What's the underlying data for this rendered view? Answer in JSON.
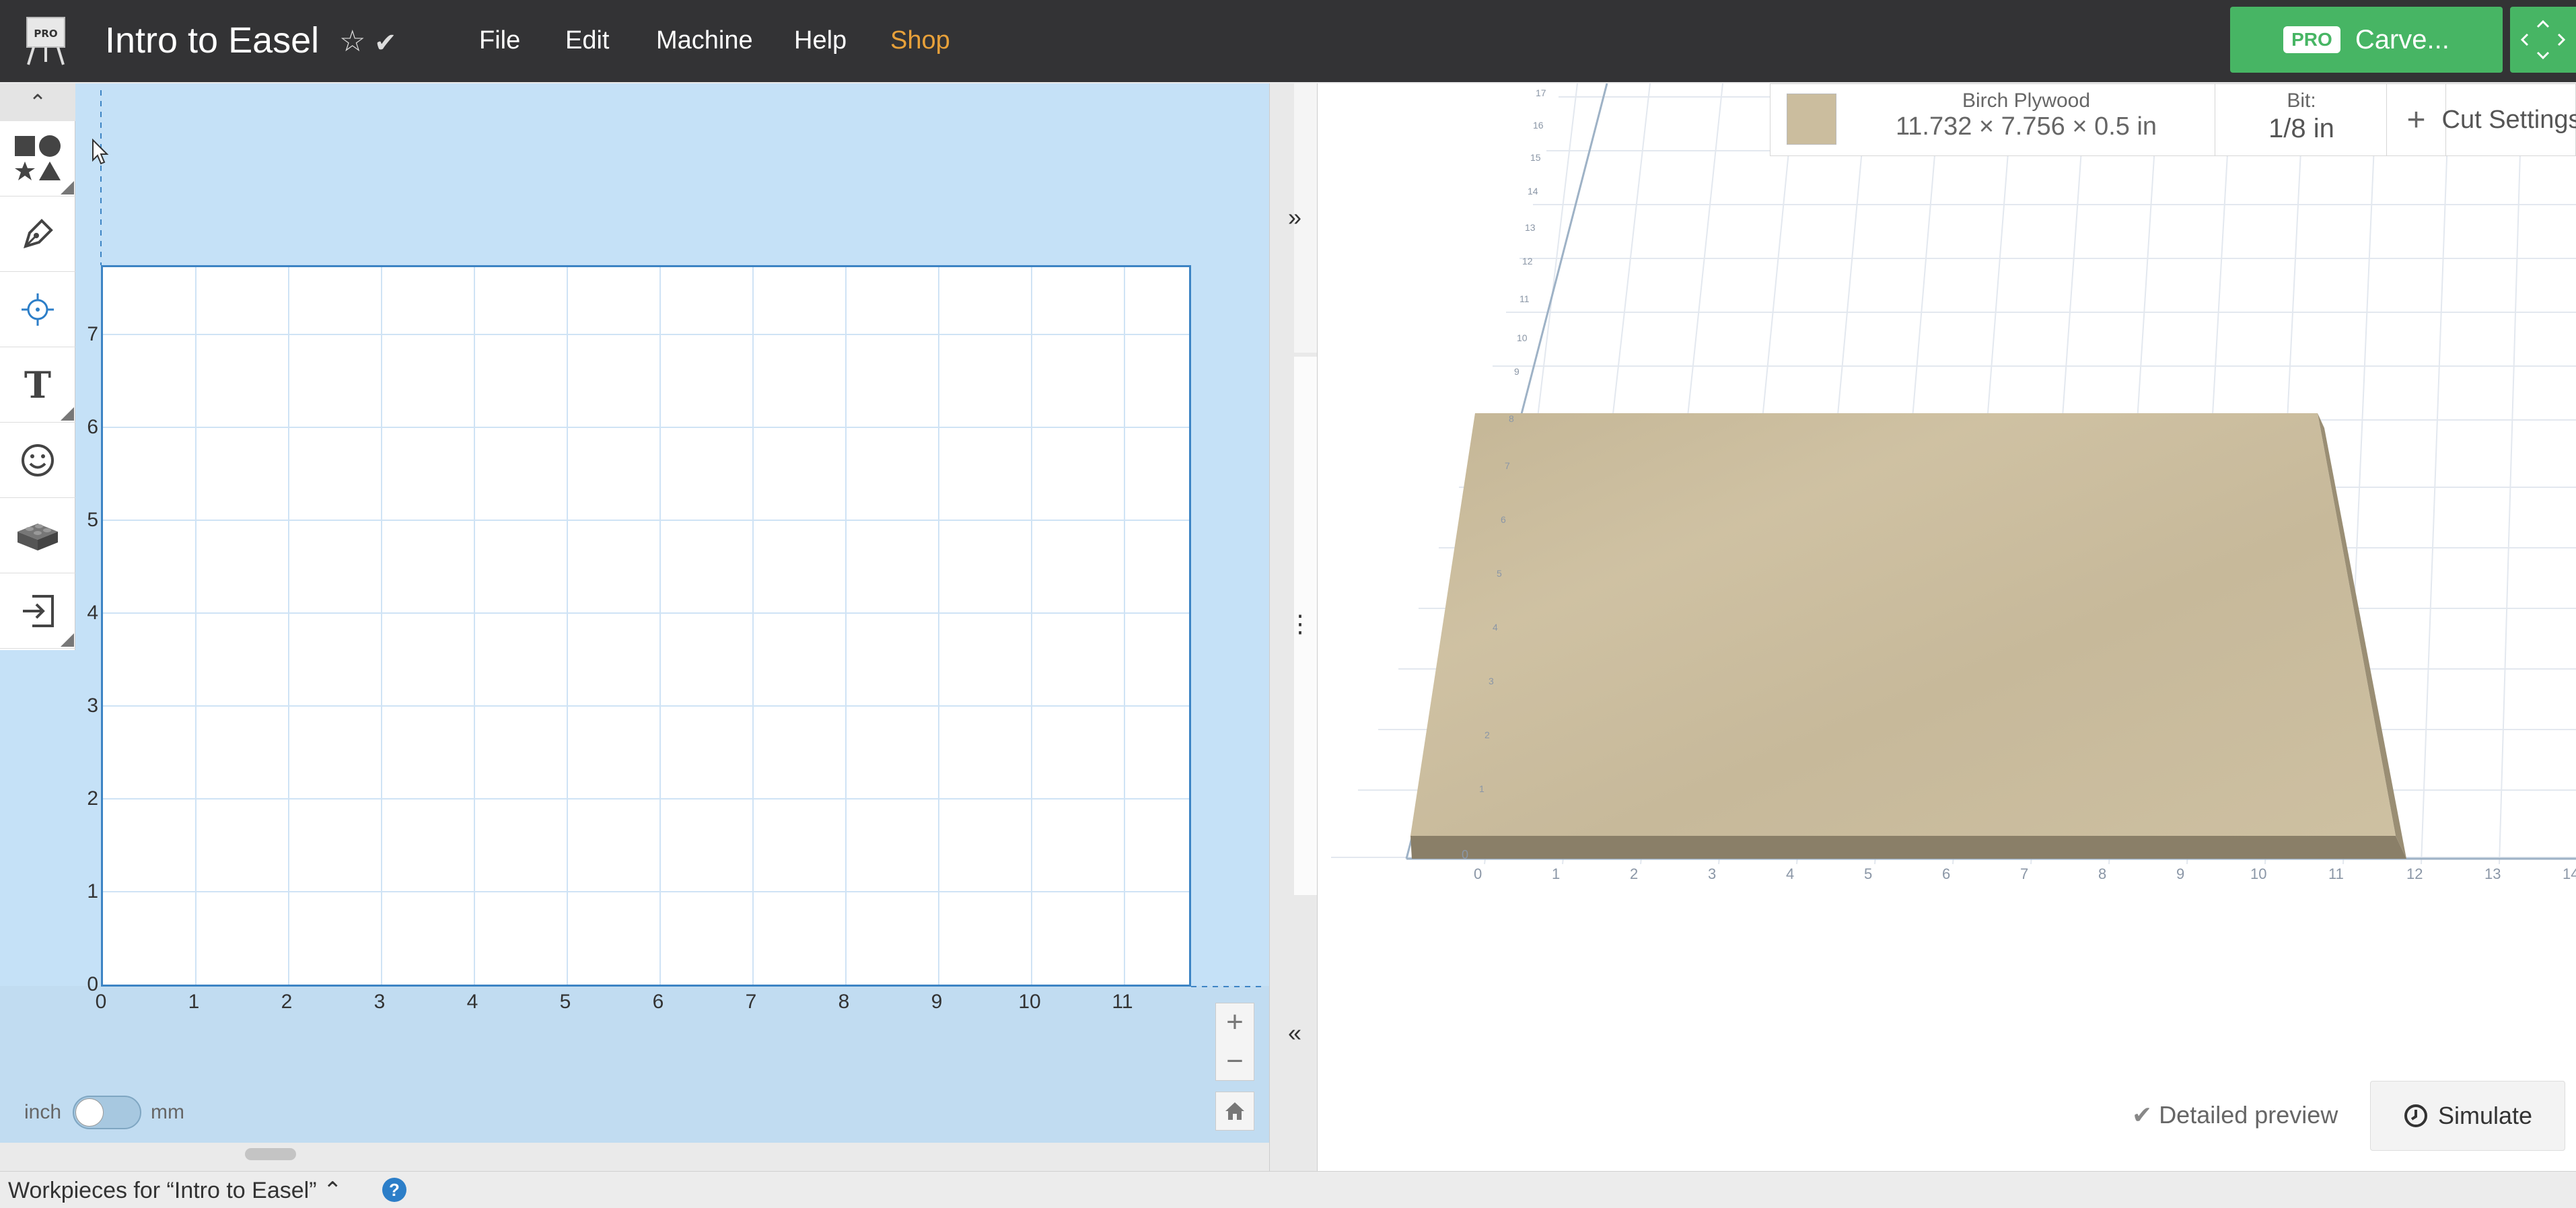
{
  "header": {
    "logo_badge": "PRO",
    "project_title": "Intro to Easel",
    "menu": [
      {
        "label": "File"
      },
      {
        "label": "Edit"
      },
      {
        "label": "Machine"
      },
      {
        "label": "Help"
      },
      {
        "label": "Shop",
        "color": "#e8a13a"
      }
    ],
    "carve_badge": "PRO",
    "carve_label": "Carve...",
    "accent_green": "#47b564"
  },
  "toolbar": {
    "tools": [
      "shapes-icon",
      "pen-icon",
      "crosshair-icon",
      "text-icon",
      "smiley-icon",
      "lego-icon",
      "import-icon"
    ],
    "text_tool_glyph": "T"
  },
  "design": {
    "y_ticks": [
      "0",
      "1",
      "2",
      "3",
      "4",
      "5",
      "6",
      "7"
    ],
    "x_ticks": [
      "0",
      "1",
      "2",
      "3",
      "4",
      "5",
      "6",
      "7",
      "8",
      "9",
      "10",
      "11"
    ],
    "unit_left": "inch",
    "unit_right": "mm",
    "unit_selected": "inch",
    "board_border_color": "#3d84c4",
    "background_color": "#c5e1f7"
  },
  "preview": {
    "material_name": "Birch Plywood",
    "material_dims": "11.732 × 7.756 × 0.5 in",
    "bit_label": "Bit:",
    "bit_value": "1/8 in",
    "add_bit": "+",
    "cut_settings": "Cut Settings",
    "detailed_preview": "Detailed preview",
    "simulate": "Simulate",
    "x_ticks": [
      "0",
      "1",
      "2",
      "3",
      "4",
      "5",
      "6",
      "7",
      "8",
      "9",
      "10",
      "11",
      "12",
      "13",
      "14"
    ],
    "y_ticks": [
      "0",
      "1",
      "2",
      "3",
      "4",
      "5",
      "6",
      "7",
      "8",
      "9",
      "10",
      "11",
      "12",
      "13",
      "14",
      "15",
      "16",
      "17"
    ],
    "wood_color": "#cbbd9e"
  },
  "bottom": {
    "workpieces_label": "Workpieces for “Intro to Easel” ⌃",
    "help": "?"
  }
}
